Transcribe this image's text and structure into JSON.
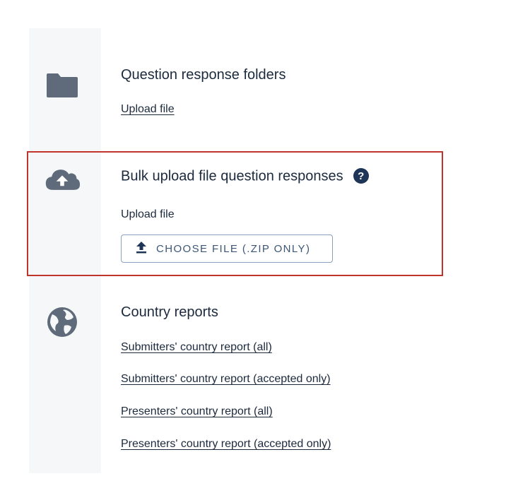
{
  "folders": {
    "title": "Question response folders",
    "link": "Upload file",
    "icon": "folder-icon"
  },
  "bulk": {
    "title": "Bulk upload file question responses",
    "help": "?",
    "label": "Upload file",
    "button": "CHOOSE FILE (.ZIP ONLY)",
    "icon": "cloud-upload-icon",
    "highlight_color": "#c0342b"
  },
  "country": {
    "title": "Country reports",
    "icon": "globe-icon",
    "links": [
      "Submitters' country report (all)",
      "Submitters' country report (accepted only)",
      "Presenters' country report (all)",
      "Presenters' country report (accepted only)"
    ]
  }
}
